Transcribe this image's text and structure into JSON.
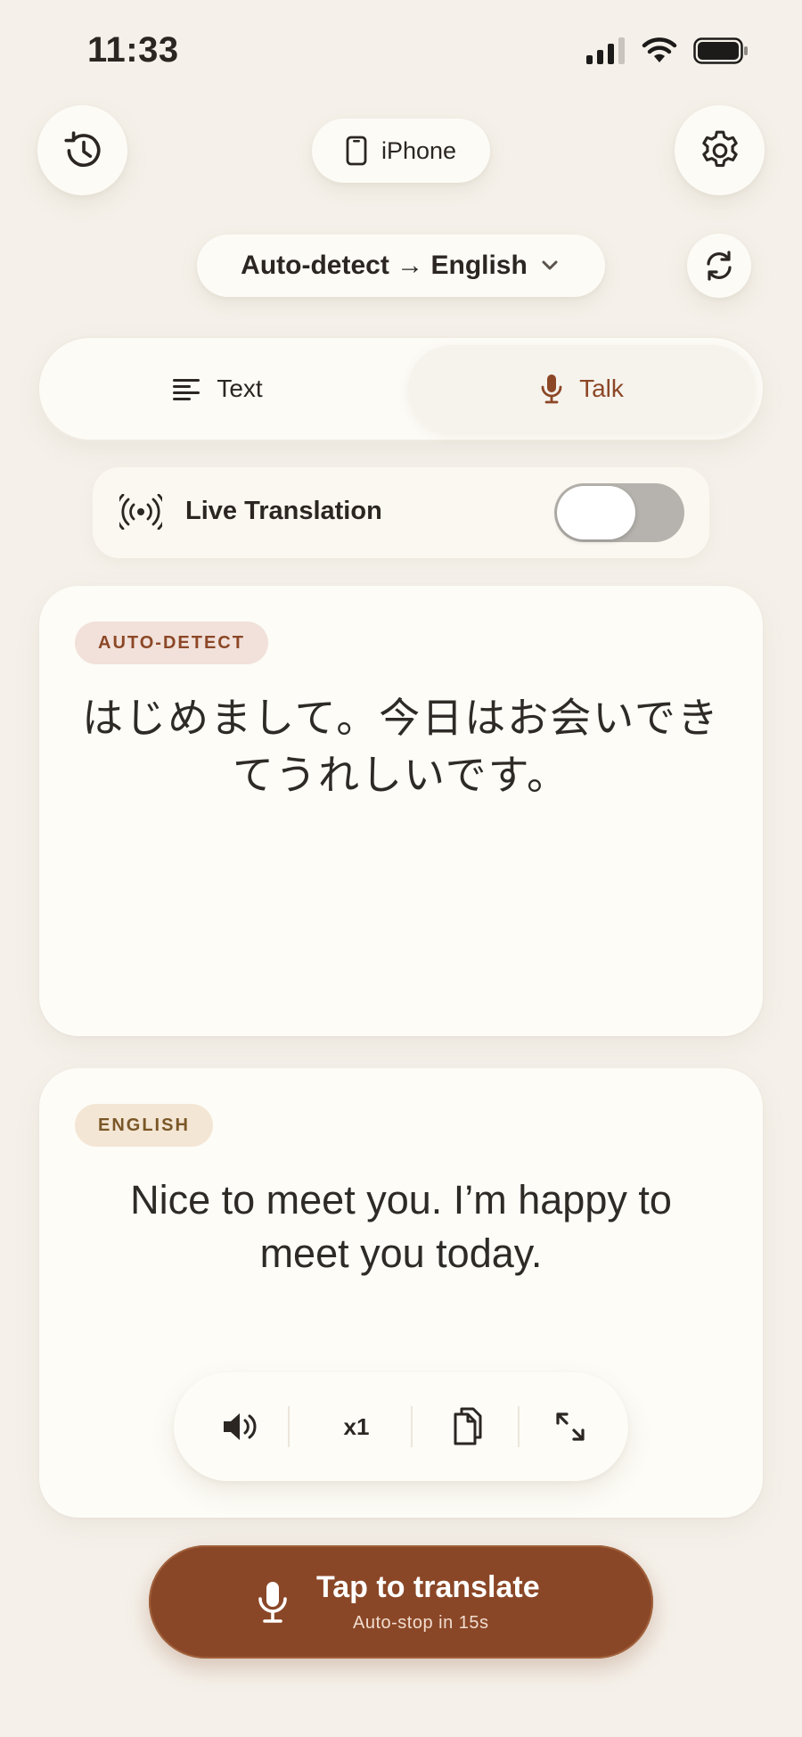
{
  "status_bar": {
    "time": "11:33"
  },
  "header": {
    "device_label": "iPhone",
    "language_selector": "Auto-detect → English"
  },
  "mode_tabs": [
    {
      "label": "Text",
      "icon": "text-lines-icon",
      "selected": false
    },
    {
      "label": "Talk",
      "icon": "microphone-icon",
      "selected": true
    }
  ],
  "live_translation": {
    "label": "Live Translation",
    "enabled": false
  },
  "source": {
    "badge": "AUTO-DETECT",
    "text": "はじめまして。今日はお会いできてうれしいです。"
  },
  "target": {
    "badge": "ENGLISH",
    "text": "Nice to meet you. I’m happy to meet you today."
  },
  "actions": {
    "speed": "x1"
  },
  "translate_button": {
    "title": "Tap to translate",
    "subtitle": "Auto-stop in 15s"
  },
  "colors": {
    "background": "#f5f1ea",
    "accent": "#8a4727",
    "card": "#fdfcf7"
  }
}
